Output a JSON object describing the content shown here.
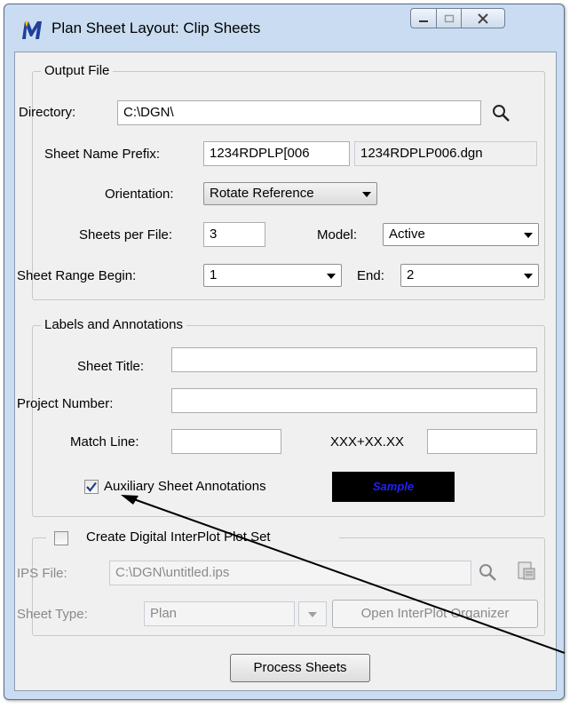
{
  "window": {
    "title": "Plan Sheet Layout: Clip Sheets"
  },
  "output_file": {
    "legend": "Output File",
    "directory_label": "Directory:",
    "directory_value": "C:\\DGN\\",
    "prefix_label": "Sheet Name Prefix:",
    "prefix_value": "1234RDPLP[006",
    "prefix_preview": "1234RDPLP006.dgn",
    "orientation_label": "Orientation:",
    "orientation_value": "Rotate Reference",
    "sheets_per_file_label": "Sheets per File:",
    "sheets_per_file_value": "3",
    "model_label": "Model:",
    "model_value": "Active",
    "range_begin_label": "Sheet Range Begin:",
    "range_begin_value": "1",
    "range_end_label": "End:",
    "range_end_value": "2"
  },
  "labels": {
    "legend": "Labels and Annotations",
    "sheet_title_label": "Sheet Title:",
    "sheet_title_value": "",
    "project_number_label": "Project Number:",
    "project_number_value": "",
    "match_line_label": "Match Line:",
    "match_line_value": "",
    "station_format": "XXX+XX.XX",
    "station_value": "",
    "aux_checkbox_label": "Auxiliary Sheet Annotations",
    "aux_checked": true,
    "sample_text": "Sample"
  },
  "interplot": {
    "checkbox_label": "Create Digital InterPlot Plot Set",
    "checked": false,
    "ips_file_label": "IPS File:",
    "ips_file_value": "C:\\DGN\\untitled.ips",
    "sheet_type_label": "Sheet Type:",
    "sheet_type_value": "Plan",
    "organizer_button": "Open InterPlot Organizer"
  },
  "actions": {
    "process_button": "Process Sheets"
  },
  "colors": {
    "title_bar": "#c9dcf1",
    "client": "#f0f0f0",
    "sample_bg": "#000000",
    "sample_text": "#2020ff"
  }
}
